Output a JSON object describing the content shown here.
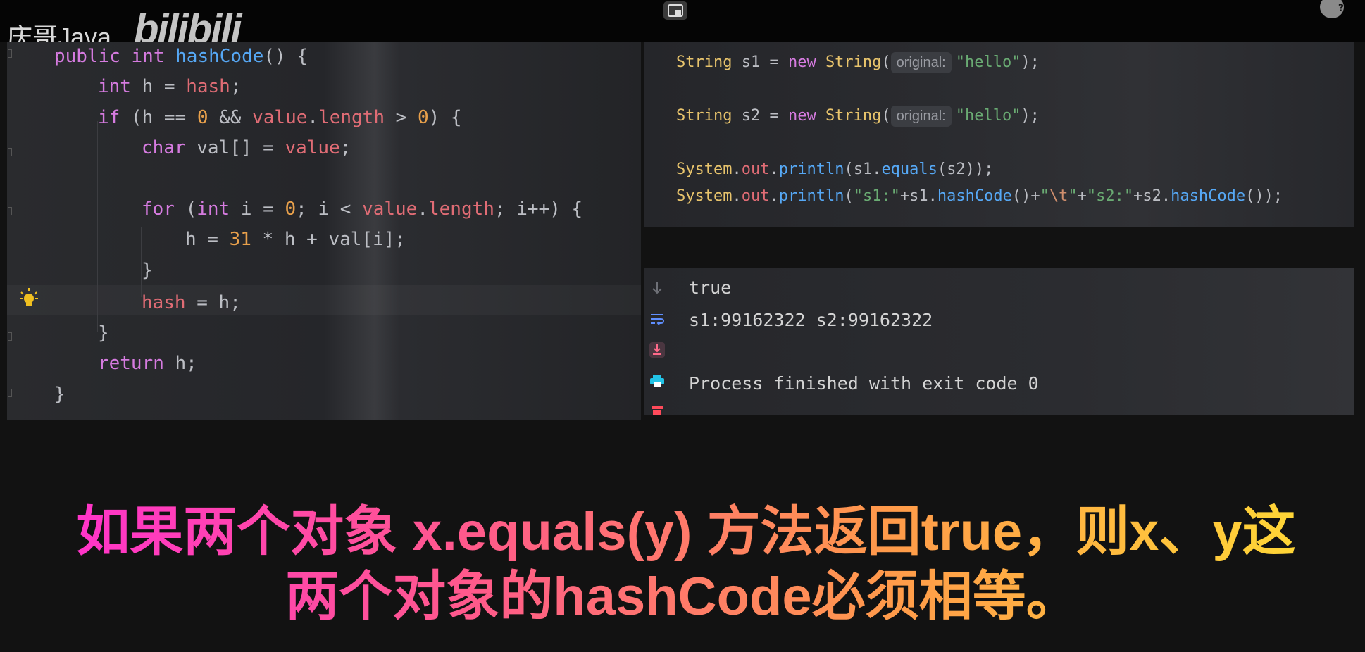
{
  "watermark": {
    "channel": "庆哥Java",
    "logo": "bilibili"
  },
  "left_code": {
    "lines": [
      [
        [
          "kw2",
          "public "
        ],
        [
          "kw2",
          "int "
        ],
        [
          "fn",
          "hashCode"
        ],
        [
          "plain",
          "() {"
        ]
      ],
      [
        [
          "kw2",
          "int "
        ],
        [
          "plain",
          "h = "
        ],
        [
          "fld",
          "hash"
        ],
        [
          "plain",
          ";"
        ]
      ],
      [
        [
          "kw2",
          "if "
        ],
        [
          "plain",
          "(h == "
        ],
        [
          "num",
          "0"
        ],
        [
          "plain",
          " && "
        ],
        [
          "fld",
          "value"
        ],
        [
          "plain",
          "."
        ],
        [
          "fld",
          "length"
        ],
        [
          "plain",
          " > "
        ],
        [
          "num",
          "0"
        ],
        [
          "plain",
          ") {"
        ]
      ],
      [
        [
          "kw2",
          "char "
        ],
        [
          "plain",
          "val[] = "
        ],
        [
          "fld",
          "value"
        ],
        [
          "plain",
          ";"
        ]
      ],
      [],
      [
        [
          "kw2",
          "for "
        ],
        [
          "plain",
          "("
        ],
        [
          "kw2",
          "int "
        ],
        [
          "plain",
          "i = "
        ],
        [
          "num",
          "0"
        ],
        [
          "plain",
          "; i < "
        ],
        [
          "fld",
          "value"
        ],
        [
          "plain",
          "."
        ],
        [
          "fld",
          "length"
        ],
        [
          "plain",
          "; i++) {"
        ]
      ],
      [
        [
          "plain",
          "h = "
        ],
        [
          "num",
          "31"
        ],
        [
          "plain",
          " * h + val[i];"
        ]
      ],
      [
        [
          "plain",
          "}"
        ]
      ],
      [
        [
          "fld",
          "hash"
        ],
        [
          "plain",
          " = h;"
        ]
      ],
      [
        [
          "plain",
          "}"
        ]
      ],
      [
        [
          "kw2",
          "return "
        ],
        [
          "plain",
          "h;"
        ]
      ],
      [
        [
          "plain",
          "}"
        ]
      ]
    ]
  },
  "right_code": {
    "hint_label": "original:",
    "lines": [
      [
        [
          "cls",
          "String "
        ],
        [
          "plain",
          "s1 = "
        ],
        [
          "kw2",
          "new "
        ],
        [
          "cls",
          "String"
        ],
        [
          "plain",
          "("
        ],
        [
          "hint",
          "original:"
        ],
        [
          "str",
          "\"hello\""
        ],
        [
          "plain",
          ");"
        ]
      ],
      [
        [
          "cls",
          "String "
        ],
        [
          "plain",
          "s2 = "
        ],
        [
          "kw2",
          "new "
        ],
        [
          "cls",
          "String"
        ],
        [
          "plain",
          "("
        ],
        [
          "hint",
          "original:"
        ],
        [
          "str",
          "\"hello\""
        ],
        [
          "plain",
          ");"
        ]
      ],
      [
        [
          "cls",
          "System"
        ],
        [
          "plain",
          "."
        ],
        [
          "fld",
          "out"
        ],
        [
          "plain",
          "."
        ],
        [
          "fn",
          "println"
        ],
        [
          "plain",
          "(s1."
        ],
        [
          "fn",
          "equals"
        ],
        [
          "plain",
          "(s2));"
        ]
      ],
      [
        [
          "cls",
          "System"
        ],
        [
          "plain",
          "."
        ],
        [
          "fld",
          "out"
        ],
        [
          "plain",
          "."
        ],
        [
          "fn",
          "println"
        ],
        [
          "plain",
          "("
        ],
        [
          "str",
          "\"s1:\""
        ],
        [
          "plain",
          "+s1."
        ],
        [
          "fn",
          "hashCode"
        ],
        [
          "plain",
          "()+"
        ],
        [
          "str",
          "\""
        ],
        [
          "esc",
          "\\t"
        ],
        [
          "str",
          "\""
        ],
        [
          "plain",
          "+"
        ],
        [
          "str",
          "\"s2:\""
        ],
        [
          "plain",
          "+s2."
        ],
        [
          "fn",
          "hashCode"
        ],
        [
          "plain",
          "());"
        ]
      ]
    ]
  },
  "console": {
    "lines": [
      "true",
      "s1:99162322 s2:99162322",
      "Process finished with exit code 0"
    ],
    "toolbar": [
      "scroll-down-icon",
      "soft-wrap-icon",
      "scroll-to-end-icon",
      "print-icon",
      "clear-icon"
    ]
  },
  "subtitle": {
    "line1": "如果两个对象 x.equals(y) 方法返回true，则x、y这",
    "line2": "两个对象的hashCode必须相等。"
  },
  "colors": {
    "background": "#121212",
    "subtitle_gradient": [
      "#ff2dd5",
      "#ff9a4a",
      "#ffe033"
    ]
  }
}
